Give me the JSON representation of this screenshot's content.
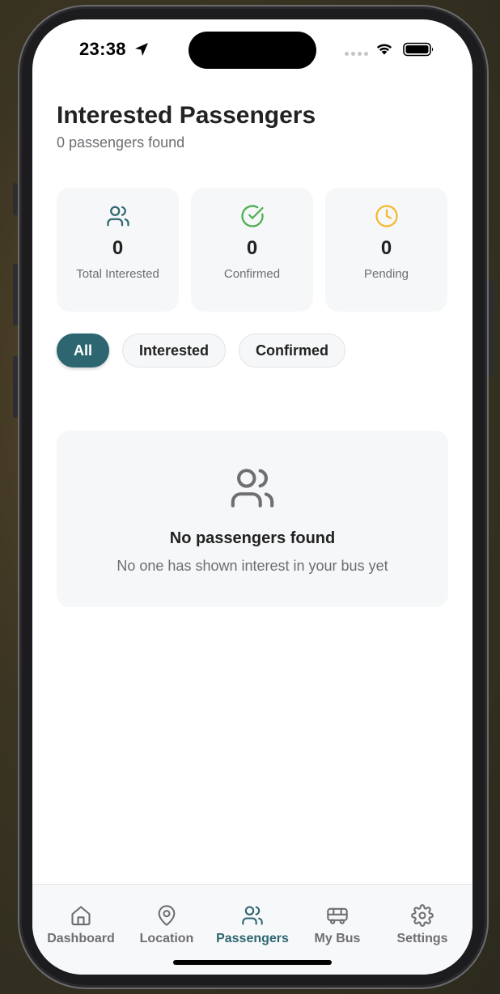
{
  "status_bar": {
    "time": "23:38"
  },
  "header": {
    "title": "Interested Passengers",
    "subtitle": "0 passengers found"
  },
  "stats": [
    {
      "value": "0",
      "label": "Total Interested",
      "icon": "users-icon",
      "color": "#2d6670"
    },
    {
      "value": "0",
      "label": "Confirmed",
      "icon": "check-circle-icon",
      "color": "#4caf50"
    },
    {
      "value": "0",
      "label": "Pending",
      "icon": "clock-icon",
      "color": "#f5b82e"
    }
  ],
  "filters": {
    "selected": "All",
    "options": [
      "All",
      "Interested",
      "Confirmed"
    ]
  },
  "empty_state": {
    "icon": "users-icon",
    "title": "No passengers found",
    "message": "No one has shown interest in your bus yet"
  },
  "tabbar": {
    "active": "Passengers",
    "items": [
      {
        "label": "Dashboard",
        "icon": "home-icon"
      },
      {
        "label": "Location",
        "icon": "map-pin-icon"
      },
      {
        "label": "Passengers",
        "icon": "users-icon"
      },
      {
        "label": "My Bus",
        "icon": "bus-icon"
      },
      {
        "label": "Settings",
        "icon": "gear-icon"
      }
    ]
  },
  "colors": {
    "accent": "#2d6670",
    "success": "#4caf50",
    "warning": "#f5b82e",
    "muted_text": "#6e6e73",
    "card_bg": "#f6f7f8"
  }
}
